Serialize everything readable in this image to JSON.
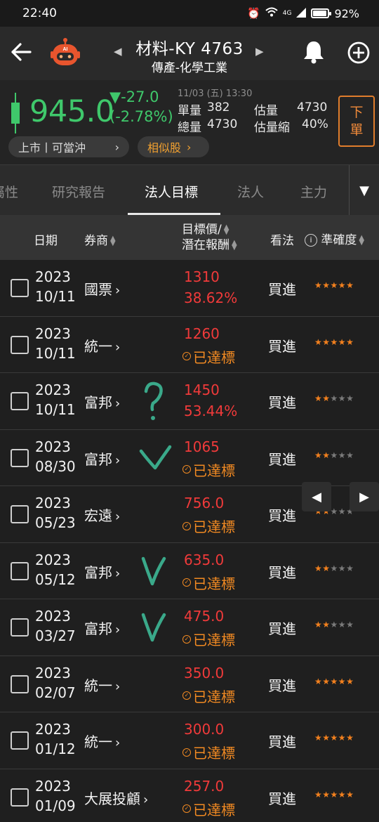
{
  "status": {
    "time": "22:40",
    "network": "4G",
    "battery": "92%"
  },
  "header": {
    "title": "材料-KY 4763",
    "subtitle": "傳產-化學工業",
    "robot_label": "AI",
    "prev_arrow": "◀",
    "next_arrow": "▶"
  },
  "quote": {
    "price": "945.0",
    "change": "▼-27.0",
    "change_pct": "(-2.78%)",
    "datetime": "11/03 (五) 13:30",
    "single_vol_label": "單量",
    "single_vol": "382",
    "total_vol_label": "總量",
    "total_vol": "4730",
    "est_vol_label": "估量",
    "est_vol": "4730",
    "est_shrink_label": "估量縮",
    "est_shrink": "40%",
    "market_chip": "上市丨可當沖",
    "similar_chip": "相似股",
    "order_label_1": "下",
    "order_label_2": "單"
  },
  "tabs": {
    "items": [
      "屬性",
      "研究報告",
      "法人目標",
      "法人",
      "主力"
    ],
    "active_index": 2
  },
  "columns": {
    "date": "日期",
    "broker": "券商",
    "target_line1": "目標價/",
    "target_line2": "潛在報酬",
    "view": "看法",
    "accuracy": "準確度"
  },
  "achieved_label": "已達標",
  "colors": {
    "up": "#3fc86b",
    "red": "#f03a3a",
    "orange": "#f28a22",
    "mark": "#3aa98a"
  },
  "rows": [
    {
      "year": "2023",
      "date": "10/11",
      "broker": "國票",
      "target": "1310",
      "ret": "38.62%",
      "achieved": false,
      "view": "買進",
      "stars": 5
    },
    {
      "year": "2023",
      "date": "10/11",
      "broker": "統一",
      "target": "1260",
      "ret": "",
      "achieved": true,
      "view": "買進",
      "stars": 5
    },
    {
      "year": "2023",
      "date": "10/11",
      "broker": "富邦",
      "target": "1450",
      "ret": "53.44%",
      "achieved": false,
      "view": "買進",
      "stars": 2
    },
    {
      "year": "2023",
      "date": "08/30",
      "broker": "富邦",
      "target": "1065",
      "ret": "",
      "achieved": true,
      "view": "買進",
      "stars": 2
    },
    {
      "year": "2023",
      "date": "05/23",
      "broker": "宏遠",
      "target": "756.0",
      "ret": "",
      "achieved": true,
      "view": "買進",
      "stars": 2
    },
    {
      "year": "2023",
      "date": "05/12",
      "broker": "富邦",
      "target": "635.0",
      "ret": "",
      "achieved": true,
      "view": "買進",
      "stars": 2
    },
    {
      "year": "2023",
      "date": "03/27",
      "broker": "富邦",
      "target": "475.0",
      "ret": "",
      "achieved": true,
      "view": "買進",
      "stars": 2
    },
    {
      "year": "2023",
      "date": "02/07",
      "broker": "統一",
      "target": "350.0",
      "ret": "",
      "achieved": true,
      "view": "買進",
      "stars": 5
    },
    {
      "year": "2023",
      "date": "01/12",
      "broker": "統一",
      "target": "300.0",
      "ret": "",
      "achieved": true,
      "view": "買進",
      "stars": 5
    },
    {
      "year": "2023",
      "date": "01/09",
      "broker": "大展投顧",
      "target": "257.0",
      "ret": "",
      "achieved": true,
      "view": "買進",
      "stars": 5
    }
  ],
  "handwritten_marks": [
    {
      "row": 2,
      "symbol": "?"
    },
    {
      "row": 3,
      "symbol": "V"
    },
    {
      "row": 5,
      "symbol": "V"
    },
    {
      "row": 6,
      "symbol": "V"
    }
  ]
}
